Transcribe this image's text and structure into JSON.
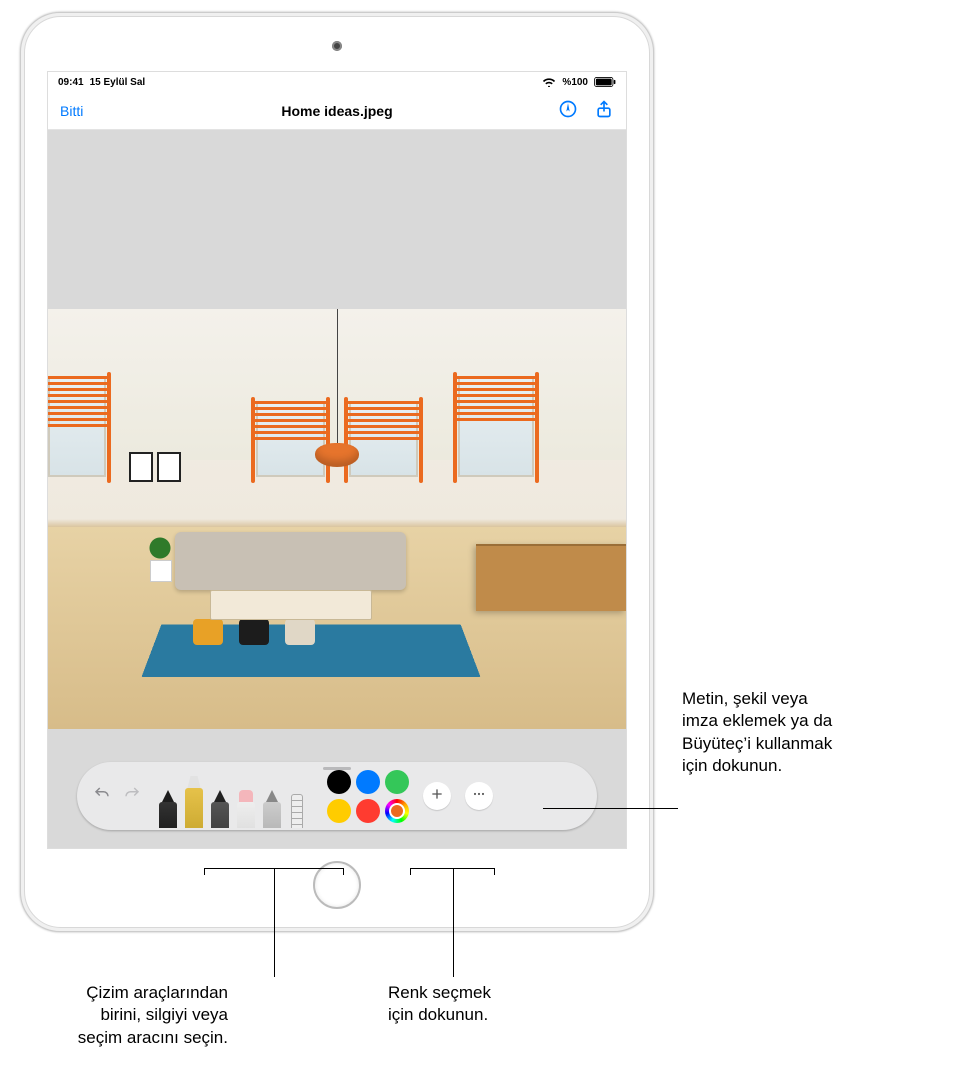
{
  "status_bar": {
    "time": "09:41",
    "date": "15 Eylül Sal",
    "battery": "%100",
    "icons": {
      "wifi": "wifi-icon",
      "battery": "battery-icon"
    }
  },
  "nav": {
    "done_label": "Bitti",
    "title": "Home ideas.jpeg",
    "markup_icon": "markup-icon",
    "share_icon": "share-icon"
  },
  "toolbar": {
    "undo": "undo",
    "redo": "redo",
    "tools": [
      {
        "name": "pen",
        "selected": false
      },
      {
        "name": "marker",
        "selected": true
      },
      {
        "name": "pencil",
        "selected": false
      },
      {
        "name": "eraser",
        "selected": false
      },
      {
        "name": "lasso",
        "selected": false
      },
      {
        "name": "ruler",
        "selected": false
      }
    ],
    "colors": [
      {
        "name": "black",
        "hex": "#000000"
      },
      {
        "name": "blue",
        "hex": "#007aff"
      },
      {
        "name": "green",
        "hex": "#34c759"
      },
      {
        "name": "yellow",
        "hex": "#ffcc00"
      },
      {
        "name": "red",
        "hex": "#ff3b30"
      },
      {
        "name": "picker",
        "hex": "colorwheel"
      }
    ],
    "add_icon": "plus-icon",
    "more_icon": "ellipsis-icon"
  },
  "markup_drawing": {
    "stroke_color": "#eb6a1f",
    "lamp_shade_color": "#e6742c"
  },
  "callouts": {
    "add_button": "Metin, şekil veya\nimza eklemek ya da\nBüyüteç’i kullanmak\niçin dokunun.",
    "drawing_tools": "Çizim araçlarından\nbirini, silgiyi veya\nseçim aracını seçin.",
    "color_picker": "Renk seçmek\niçin dokunun."
  }
}
